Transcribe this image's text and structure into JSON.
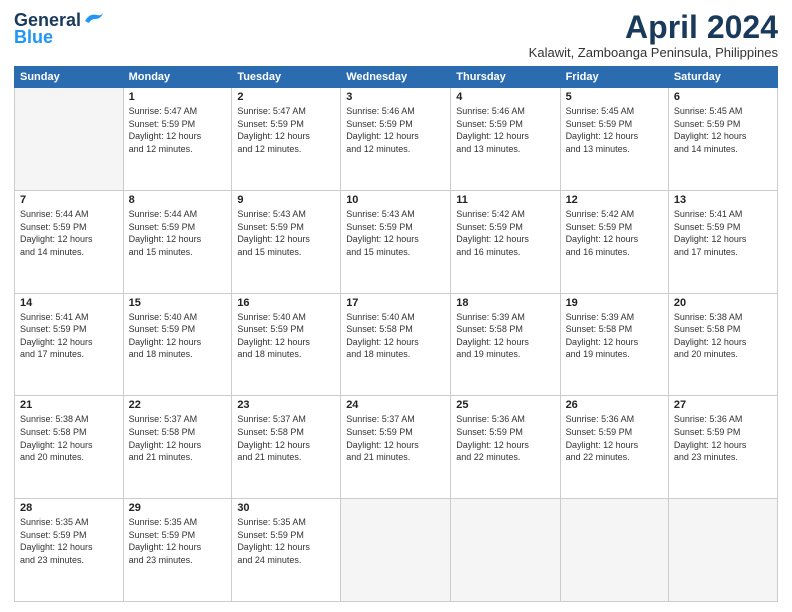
{
  "header": {
    "logo_general": "General",
    "logo_blue": "Blue",
    "month_title": "April 2024",
    "location": "Kalawit, Zamboanga Peninsula, Philippines"
  },
  "days_of_week": [
    "Sunday",
    "Monday",
    "Tuesday",
    "Wednesday",
    "Thursday",
    "Friday",
    "Saturday"
  ],
  "weeks": [
    [
      {
        "day": "",
        "sunrise": "",
        "sunset": "",
        "daylight": ""
      },
      {
        "day": "1",
        "sunrise": "Sunrise: 5:47 AM",
        "sunset": "Sunset: 5:59 PM",
        "daylight": "Daylight: 12 hours and 12 minutes."
      },
      {
        "day": "2",
        "sunrise": "Sunrise: 5:47 AM",
        "sunset": "Sunset: 5:59 PM",
        "daylight": "Daylight: 12 hours and 12 minutes."
      },
      {
        "day": "3",
        "sunrise": "Sunrise: 5:46 AM",
        "sunset": "Sunset: 5:59 PM",
        "daylight": "Daylight: 12 hours and 12 minutes."
      },
      {
        "day": "4",
        "sunrise": "Sunrise: 5:46 AM",
        "sunset": "Sunset: 5:59 PM",
        "daylight": "Daylight: 12 hours and 13 minutes."
      },
      {
        "day": "5",
        "sunrise": "Sunrise: 5:45 AM",
        "sunset": "Sunset: 5:59 PM",
        "daylight": "Daylight: 12 hours and 13 minutes."
      },
      {
        "day": "6",
        "sunrise": "Sunrise: 5:45 AM",
        "sunset": "Sunset: 5:59 PM",
        "daylight": "Daylight: 12 hours and 14 minutes."
      }
    ],
    [
      {
        "day": "7",
        "sunrise": "Sunrise: 5:44 AM",
        "sunset": "Sunset: 5:59 PM",
        "daylight": "Daylight: 12 hours and 14 minutes."
      },
      {
        "day": "8",
        "sunrise": "Sunrise: 5:44 AM",
        "sunset": "Sunset: 5:59 PM",
        "daylight": "Daylight: 12 hours and 15 minutes."
      },
      {
        "day": "9",
        "sunrise": "Sunrise: 5:43 AM",
        "sunset": "Sunset: 5:59 PM",
        "daylight": "Daylight: 12 hours and 15 minutes."
      },
      {
        "day": "10",
        "sunrise": "Sunrise: 5:43 AM",
        "sunset": "Sunset: 5:59 PM",
        "daylight": "Daylight: 12 hours and 15 minutes."
      },
      {
        "day": "11",
        "sunrise": "Sunrise: 5:42 AM",
        "sunset": "Sunset: 5:59 PM",
        "daylight": "Daylight: 12 hours and 16 minutes."
      },
      {
        "day": "12",
        "sunrise": "Sunrise: 5:42 AM",
        "sunset": "Sunset: 5:59 PM",
        "daylight": "Daylight: 12 hours and 16 minutes."
      },
      {
        "day": "13",
        "sunrise": "Sunrise: 5:41 AM",
        "sunset": "Sunset: 5:59 PM",
        "daylight": "Daylight: 12 hours and 17 minutes."
      }
    ],
    [
      {
        "day": "14",
        "sunrise": "Sunrise: 5:41 AM",
        "sunset": "Sunset: 5:59 PM",
        "daylight": "Daylight: 12 hours and 17 minutes."
      },
      {
        "day": "15",
        "sunrise": "Sunrise: 5:40 AM",
        "sunset": "Sunset: 5:59 PM",
        "daylight": "Daylight: 12 hours and 18 minutes."
      },
      {
        "day": "16",
        "sunrise": "Sunrise: 5:40 AM",
        "sunset": "Sunset: 5:59 PM",
        "daylight": "Daylight: 12 hours and 18 minutes."
      },
      {
        "day": "17",
        "sunrise": "Sunrise: 5:40 AM",
        "sunset": "Sunset: 5:58 PM",
        "daylight": "Daylight: 12 hours and 18 minutes."
      },
      {
        "day": "18",
        "sunrise": "Sunrise: 5:39 AM",
        "sunset": "Sunset: 5:58 PM",
        "daylight": "Daylight: 12 hours and 19 minutes."
      },
      {
        "day": "19",
        "sunrise": "Sunrise: 5:39 AM",
        "sunset": "Sunset: 5:58 PM",
        "daylight": "Daylight: 12 hours and 19 minutes."
      },
      {
        "day": "20",
        "sunrise": "Sunrise: 5:38 AM",
        "sunset": "Sunset: 5:58 PM",
        "daylight": "Daylight: 12 hours and 20 minutes."
      }
    ],
    [
      {
        "day": "21",
        "sunrise": "Sunrise: 5:38 AM",
        "sunset": "Sunset: 5:58 PM",
        "daylight": "Daylight: 12 hours and 20 minutes."
      },
      {
        "day": "22",
        "sunrise": "Sunrise: 5:37 AM",
        "sunset": "Sunset: 5:58 PM",
        "daylight": "Daylight: 12 hours and 21 minutes."
      },
      {
        "day": "23",
        "sunrise": "Sunrise: 5:37 AM",
        "sunset": "Sunset: 5:58 PM",
        "daylight": "Daylight: 12 hours and 21 minutes."
      },
      {
        "day": "24",
        "sunrise": "Sunrise: 5:37 AM",
        "sunset": "Sunset: 5:59 PM",
        "daylight": "Daylight: 12 hours and 21 minutes."
      },
      {
        "day": "25",
        "sunrise": "Sunrise: 5:36 AM",
        "sunset": "Sunset: 5:59 PM",
        "daylight": "Daylight: 12 hours and 22 minutes."
      },
      {
        "day": "26",
        "sunrise": "Sunrise: 5:36 AM",
        "sunset": "Sunset: 5:59 PM",
        "daylight": "Daylight: 12 hours and 22 minutes."
      },
      {
        "day": "27",
        "sunrise": "Sunrise: 5:36 AM",
        "sunset": "Sunset: 5:59 PM",
        "daylight": "Daylight: 12 hours and 23 minutes."
      }
    ],
    [
      {
        "day": "28",
        "sunrise": "Sunrise: 5:35 AM",
        "sunset": "Sunset: 5:59 PM",
        "daylight": "Daylight: 12 hours and 23 minutes."
      },
      {
        "day": "29",
        "sunrise": "Sunrise: 5:35 AM",
        "sunset": "Sunset: 5:59 PM",
        "daylight": "Daylight: 12 hours and 23 minutes."
      },
      {
        "day": "30",
        "sunrise": "Sunrise: 5:35 AM",
        "sunset": "Sunset: 5:59 PM",
        "daylight": "Daylight: 12 hours and 24 minutes."
      },
      {
        "day": "",
        "sunrise": "",
        "sunset": "",
        "daylight": ""
      },
      {
        "day": "",
        "sunrise": "",
        "sunset": "",
        "daylight": ""
      },
      {
        "day": "",
        "sunrise": "",
        "sunset": "",
        "daylight": ""
      },
      {
        "day": "",
        "sunrise": "",
        "sunset": "",
        "daylight": ""
      }
    ]
  ]
}
